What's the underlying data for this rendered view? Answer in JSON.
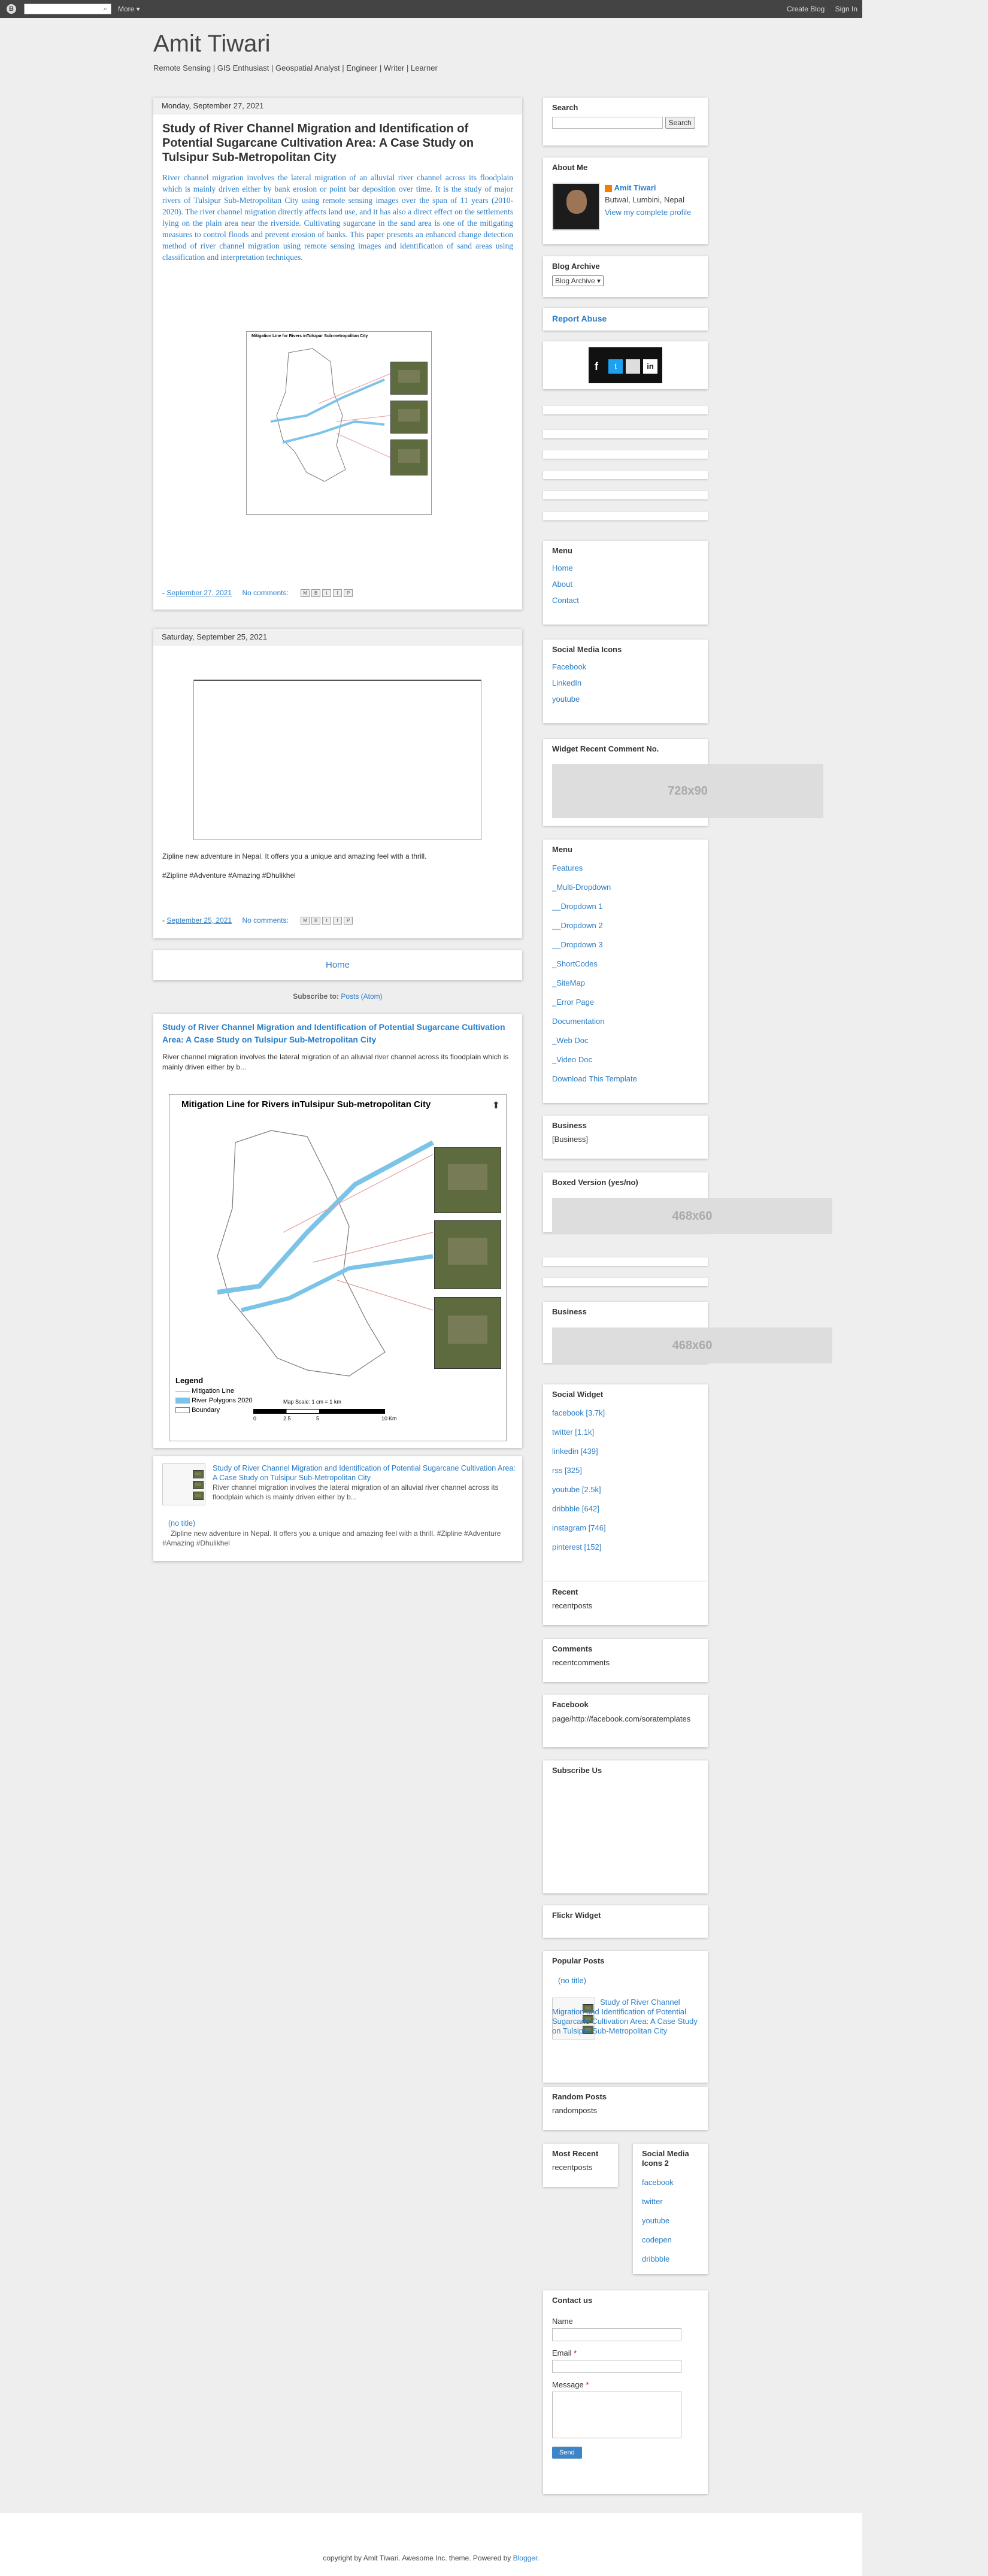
{
  "navbar": {
    "logo": "B",
    "more": "More ▾",
    "create_blog": "Create Blog",
    "sign_in": "Sign In"
  },
  "header": {
    "title": "Amit Tiwari",
    "description": "Remote Sensing | GIS Enthusiast | Geospatial Analyst | Engineer | Writer | Learner"
  },
  "posts": [
    {
      "date": "Monday, September 27, 2021",
      "title": "Study of River Channel Migration and Identification of Potential Sugarcane Cultivation Area: A Case Study on Tulsipur Sub-Metropolitan City",
      "body": "River channel migration involves the lateral migration of an alluvial river channel across its floodplain which is mainly driven either by bank erosion or point bar deposition over time. It is the study of major rivers of Tulsipur Sub-Metropolitan City using remote sensing images over the span of 11 years (2010-2020). The river channel migration directly affects land use, and it has also a direct effect on the settlements lying on the plain area near the riverside. Cultivating sugarcane in the sand area is one of the mitigating measures to control floods and prevent erosion of banks. This paper presents an enhanced change detection method of river channel migration using remote sensing images and identification of sand areas using classification and interpretation techniques.",
      "map_title": "Mitigation Line for Rivers inTulsipur Sub-metropolitan City",
      "footer_dash": "-",
      "footer_date": "September 27, 2021",
      "comments": "No comments:"
    },
    {
      "date": "Saturday, September 25, 2021",
      "text1": "Zipline new adventure in Nepal. It offers you a unique and amazing feel with a thrill.",
      "text2": "#Zipline #Adventure #Amazing #Dhulikhel",
      "footer_dash": "-",
      "footer_date": "September 25, 2021",
      "comments": "No comments:"
    }
  ],
  "share_icons": [
    "M",
    "B",
    "t",
    "f",
    "P"
  ],
  "home_link": "Home",
  "subscribe": {
    "label": "Subscribe to:",
    "link": "Posts (Atom)"
  },
  "featured": {
    "title": "Study of River Channel Migration and Identification of Potential Sugarcane Cultivation Area: A Case Study on Tulsipur Sub-Metropolitan City",
    "snippet": "River channel migration involves the lateral migration of an alluvial river channel across its floodplain which is mainly driven either by b...",
    "map_title": "Mitigation Line for Rivers inTulsipur Sub-metropolitan City",
    "legend_title": "Legend",
    "legend_items": [
      "Mitigation Line",
      "River Polygons 2020",
      "Boundary"
    ],
    "map_scale": "Map Scale:",
    "map_scale_value": "1 cm = 1 km",
    "scale_ticks": [
      "0",
      "2.5",
      "5",
      "10"
    ],
    "scale_unit": "Km"
  },
  "related": [
    {
      "title": "Study of River Channel Migration and Identification of Potential Sugarcane Cultivation Area: A Case Study on Tulsipur Sub-Metropolitan City",
      "snippet": "River channel migration involves the lateral migration of an alluvial river channel across its floodplain which is mainly driven either by b..."
    },
    {
      "title": "(no title)",
      "snippet": "Zipline new adventure in Nepal. It offers you a unique and amazing feel with a thrill. #Zipline #Adventure #Amazing #Dhulikhel"
    }
  ],
  "sidebar": {
    "search": {
      "title": "Search",
      "button": "Search"
    },
    "about": {
      "title": "About Me",
      "name": "Amit Tiwari",
      "location": "Butwal, Lumbini, Nepal",
      "profile_link": "View my complete profile"
    },
    "archive": {
      "title": "Blog Archive",
      "selected": "Blog Archive"
    },
    "report_abuse": "Report Abuse",
    "menu1": {
      "title": "Menu",
      "items": [
        "Home",
        "About",
        "Contact"
      ]
    },
    "social_icons": {
      "title": "Social Media Icons",
      "items": [
        "Facebook",
        "LinkedIn",
        "youtube"
      ]
    },
    "widget_comment": {
      "title": "Widget Recent Comment No.",
      "ad": "728x90"
    },
    "menu2": {
      "title": "Menu",
      "items": [
        "Features",
        "_Multi-Dropdown",
        "__Dropdown 1",
        "__Dropdown 2",
        "__Dropdown 3",
        "_ShortCodes",
        "_SiteMap",
        "_Error Page",
        "Documentation",
        "_Web Doc",
        "_Video Doc",
        "Download This Template"
      ]
    },
    "business1": {
      "title": "Business",
      "value": "[Business]"
    },
    "boxed": {
      "title": "Boxed Version (yes/no)",
      "ad": "468x60"
    },
    "business2": {
      "title": "Business",
      "ad": "468x60"
    },
    "social_widget": {
      "title": "Social Widget",
      "items": [
        "facebook [3.7k]",
        "twitter [1.1k]",
        "linkedin [439]",
        "rss [325]",
        "youtube [2.5k]",
        "dribbble [642]",
        "instagram [746]",
        "pinterest [152]"
      ]
    },
    "recent": {
      "title": "Recent",
      "value": "recentposts"
    },
    "comments": {
      "title": "Comments",
      "value": "recentcomments"
    },
    "facebook": {
      "title": "Facebook",
      "value": "page/http://facebook.com/soratemplates"
    },
    "subscribe_us": {
      "title": "Subscribe Us"
    },
    "flickr": {
      "title": "Flickr Widget"
    },
    "popular": {
      "title": "Popular Posts",
      "item1": "(no title)",
      "item2": "Study of River Channel Migration and Identification of Potential Sugarcane Cultivation Area: A Case Study on Tulsipur Sub-Metropolitan City"
    },
    "random": {
      "title": "Random Posts",
      "value": "randomposts"
    },
    "most_recent": {
      "title": "Most Recent",
      "value": "recentposts"
    },
    "social2": {
      "title": "Social Media Icons 2",
      "items": [
        "facebook",
        "twitter",
        "youtube",
        "codepen",
        "dribbble"
      ]
    },
    "contact": {
      "title": "Contact us",
      "name": "Name",
      "email": "Email",
      "message": "Message",
      "required": "*",
      "send": "Send"
    }
  },
  "footer": {
    "text": "copyright by Amit Tiwari. Awesome Inc. theme. Powered by",
    "link": "Blogger."
  }
}
